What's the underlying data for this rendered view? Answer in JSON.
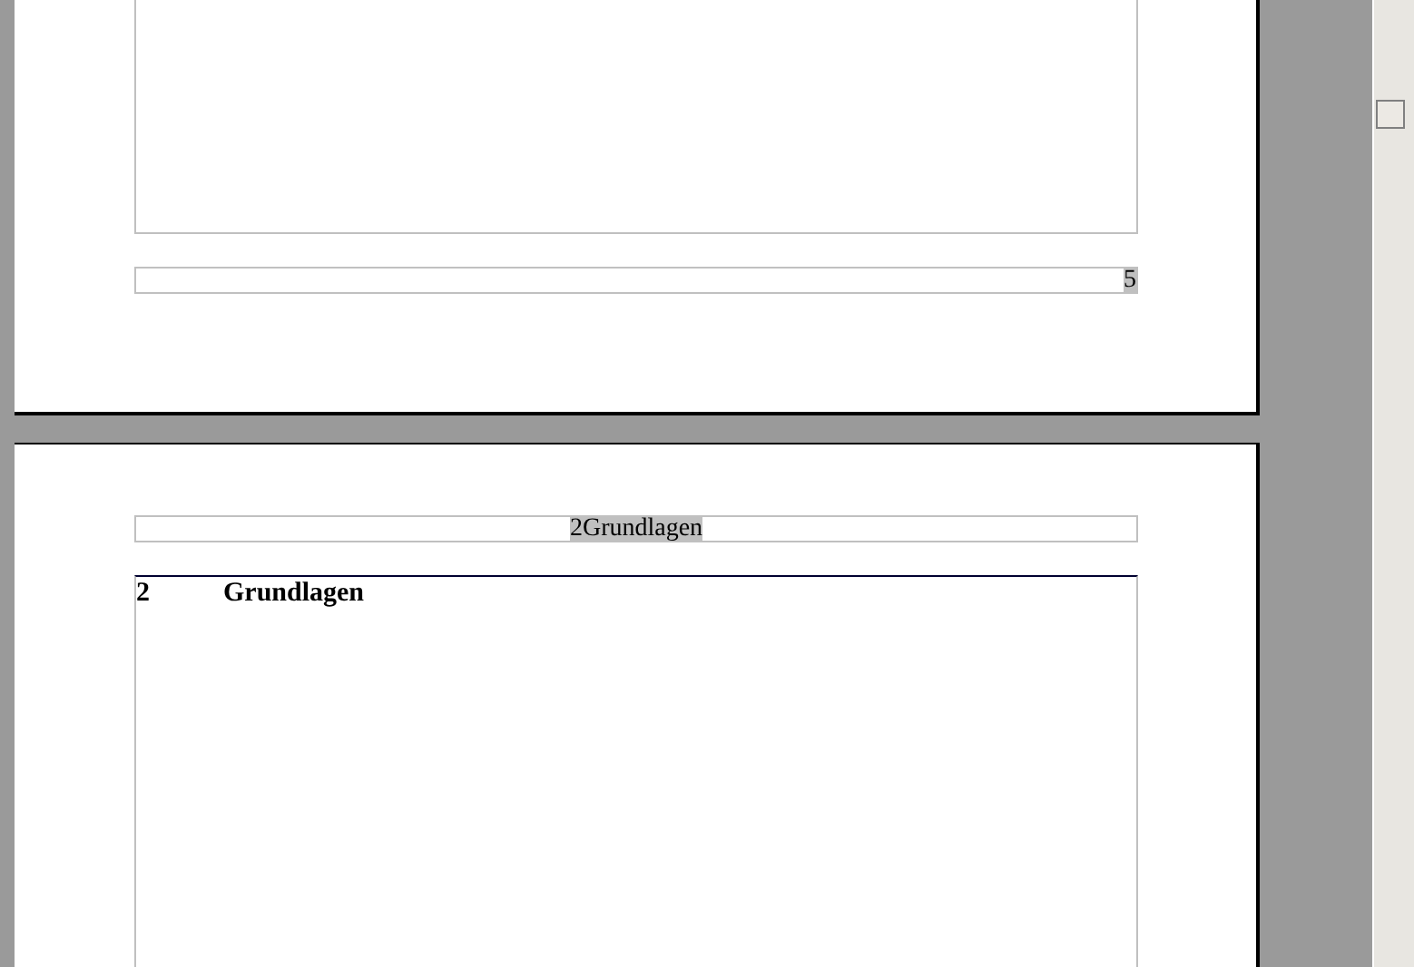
{
  "pages": [
    {
      "kind": "footer-page",
      "footer": {
        "text": "5"
      }
    },
    {
      "kind": "chapter-page",
      "header": {
        "text": "2Grundlagen"
      },
      "heading": {
        "number": "2",
        "title": "Grundlagen"
      }
    }
  ]
}
